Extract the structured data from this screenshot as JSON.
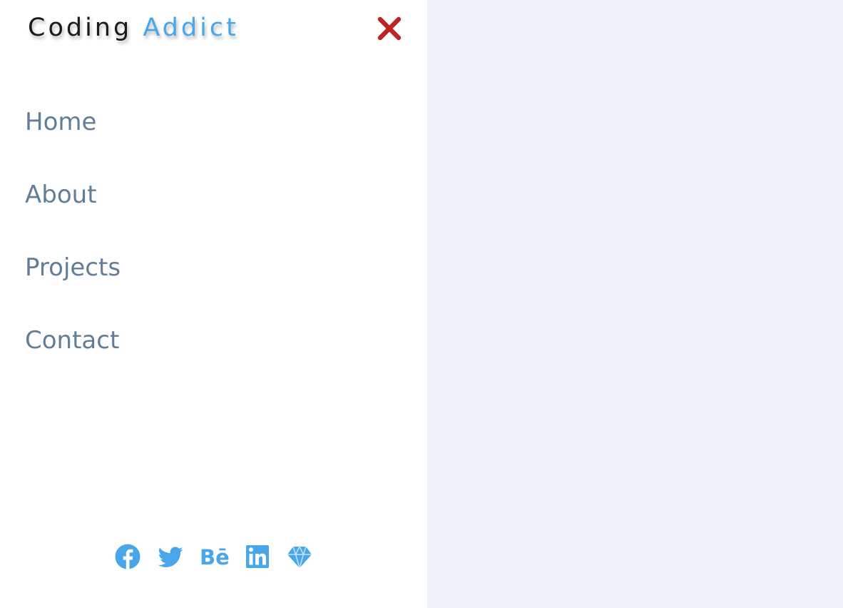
{
  "logo": {
    "word1": "Coding",
    "word2": "Addict"
  },
  "close": {
    "icon": "close-icon",
    "color": "#bb2525"
  },
  "nav": {
    "items": [
      {
        "label": "Home"
      },
      {
        "label": "About"
      },
      {
        "label": "Projects"
      },
      {
        "label": "Contact"
      }
    ]
  },
  "social": {
    "icons": [
      "facebook-icon",
      "twitter-icon",
      "behance-icon",
      "linkedin-icon",
      "sketch-icon"
    ]
  },
  "colors": {
    "accent": "#49a6e9",
    "nav_text": "#617d98",
    "close": "#bb2525",
    "main_bg": "#f0f4f8",
    "sidebar_bg": "#ffffff"
  }
}
